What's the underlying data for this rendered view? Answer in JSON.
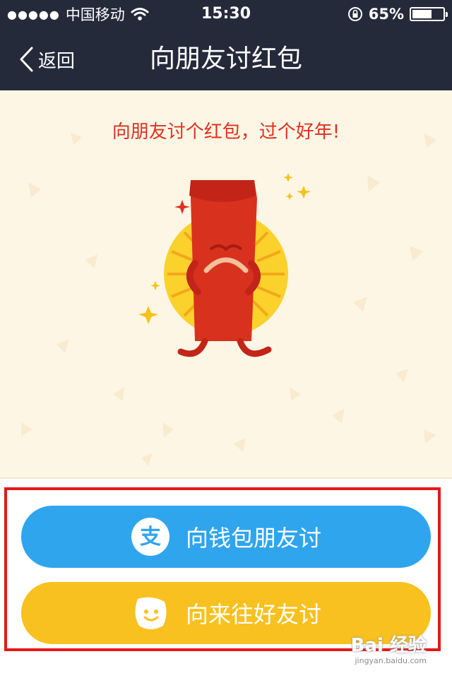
{
  "status_bar": {
    "signal_dots": "●●●●●",
    "carrier": "中国移动",
    "time": "15:30",
    "battery_percent": "65%",
    "battery_level": 0.65
  },
  "nav": {
    "back_label": "返回",
    "title": "向朋友讨红包"
  },
  "content": {
    "tagline": "向朋友讨个红包，过个好年!"
  },
  "actions": {
    "wallet_friends": "向钱包朋友讨",
    "laiwang_friends": "向来往好友讨"
  },
  "watermark": {
    "main": "Bai 经验",
    "sub": "jingyan.baidu.com"
  },
  "colors": {
    "nav_bg": "#252A3B",
    "content_bg": "#FEF6E5",
    "tagline": "#E0301E",
    "button_blue": "#2FA5EE",
    "button_yellow": "#F9C11F",
    "highlight_border": "#E61717"
  },
  "icons": {
    "signal": "signal-dots-icon",
    "wifi": "wifi-icon",
    "rotation_lock": "rotation-lock-icon",
    "battery": "battery-icon",
    "back": "chevron-left-icon",
    "alipay": "alipay-icon",
    "laiwang": "laiwang-smiley-icon",
    "red_envelope": "red-envelope-mascot-illustration"
  }
}
